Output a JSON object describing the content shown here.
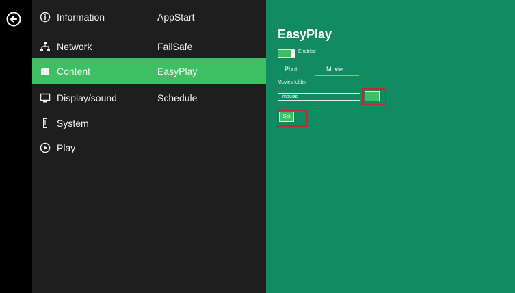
{
  "nav": {
    "categories": [
      {
        "label": "Information",
        "icon": "info-icon"
      },
      {
        "label": "Network",
        "icon": "network-icon"
      },
      {
        "label": "Content",
        "icon": "folder-icon"
      },
      {
        "label": "Display/sound",
        "icon": "display-icon"
      },
      {
        "label": "System",
        "icon": "system-icon"
      },
      {
        "label": "Play",
        "icon": "play-icon"
      }
    ],
    "subitems": [
      {
        "label": "AppStart"
      },
      {
        "label": "FailSafe"
      },
      {
        "label": "EasyPlay",
        "selected": true
      },
      {
        "label": "Schedule"
      }
    ],
    "selected_category": "Content"
  },
  "panel": {
    "title": "EasyPlay",
    "toggle_label": "Enabled",
    "toggle_on": true,
    "tabs": [
      {
        "label": "Photo"
      },
      {
        "label": "Movie",
        "active": true
      }
    ],
    "folder_label": "Movies folder",
    "folder_value": "movies",
    "browse_label": "...",
    "set_label": "Set"
  },
  "colors": {
    "rail": "#000000",
    "nav_bg": "#1e1e1e",
    "selected": "#3ebf63",
    "panel_bg": "#128a62",
    "highlight": "#c8272d"
  }
}
